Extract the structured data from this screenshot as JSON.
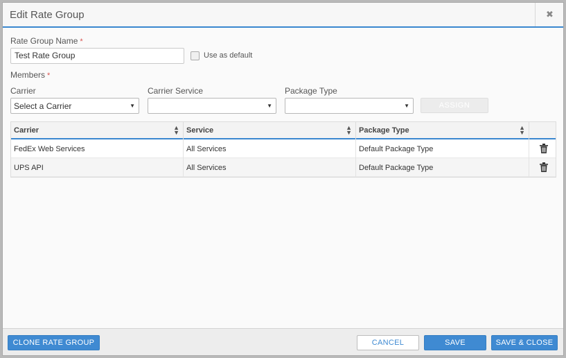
{
  "dialog": {
    "title": "Edit Rate Group",
    "close_symbol": "✖"
  },
  "form": {
    "rate_group_name_label": "Rate Group Name",
    "required_marker": "*",
    "rate_group_name_value": "Test Rate Group",
    "use_as_default_label": "Use as default",
    "members_label": "Members",
    "carrier_label": "Carrier",
    "carrier_service_label": "Carrier Service",
    "package_type_label": "Package Type",
    "carrier_select_value": "Select a Carrier",
    "carrier_service_select_value": "",
    "package_type_select_value": "",
    "assign_label": "ASSIGN"
  },
  "table": {
    "headers": [
      "Carrier",
      "Service",
      "Package Type"
    ],
    "rows": [
      [
        "FedEx Web Services",
        "All Services",
        "Default Package Type"
      ],
      [
        "UPS API",
        "All Services",
        "Default Package Type"
      ]
    ]
  },
  "footer": {
    "clone_label": "CLONE RATE GROUP",
    "cancel_label": "CANCEL",
    "save_label": "SAVE",
    "save_close_label": "SAVE & CLOSE"
  },
  "icons": {
    "sort": "sort-icon",
    "delete": "trash-icon",
    "dropdown": "caret-down-icon"
  },
  "colors": {
    "accent": "#3f8ad2",
    "required": "#d9534f"
  }
}
